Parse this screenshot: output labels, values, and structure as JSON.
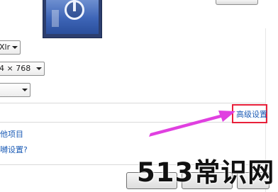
{
  "display": {
    "orientation_value": "Xlr",
    "resolution_value": "4 × 768",
    "third_select_value": ""
  },
  "links": {
    "advanced_settings": "高级设置",
    "other_items": "他项目",
    "which_settings": "嚩设置?"
  },
  "highlight_color": "#e8203a",
  "arrow_color": "#e040e0",
  "watermark": "513常识网"
}
